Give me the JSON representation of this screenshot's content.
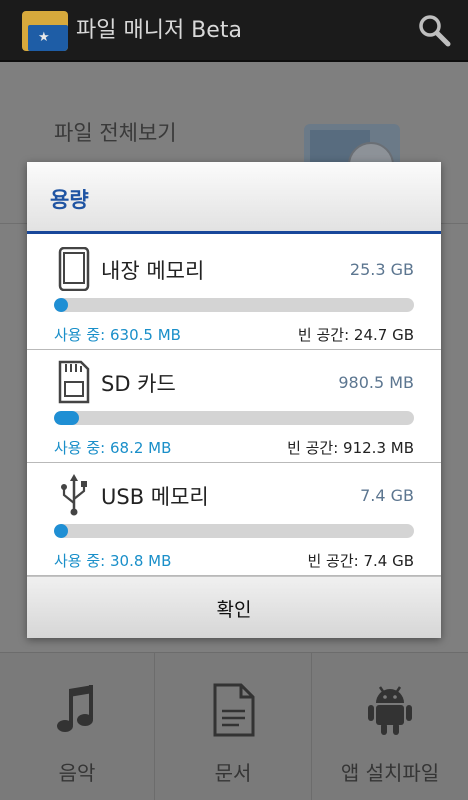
{
  "app": {
    "title": "파일 매니저 Beta",
    "icon": "folder-flag-icon",
    "search_icon": "search-icon"
  },
  "background": {
    "row1_label": "파일 전체보기",
    "bottom_items": [
      {
        "label": "음악",
        "icon": "music-note-icon"
      },
      {
        "label": "문서",
        "icon": "document-icon"
      },
      {
        "label": "앱 설치파일",
        "icon": "android-icon"
      }
    ]
  },
  "dialog": {
    "title": "용량",
    "ok_label": "확인",
    "storages": [
      {
        "name": "내장 메모리",
        "icon": "phone-icon",
        "total": "25.3 GB",
        "used": "사용 중: 630.5 MB",
        "free": "빈 공간: 24.7 GB",
        "usage_fraction": 0.025
      },
      {
        "name": "SD 카드",
        "icon": "sd-card-icon",
        "total": "980.5 MB",
        "used": "사용 중: 68.2 MB",
        "free": "빈 공간: 912.3 MB",
        "usage_fraction": 0.07
      },
      {
        "name": "USB 메모리",
        "icon": "usb-icon",
        "total": "7.4 GB",
        "used": "사용 중: 30.8 MB",
        "free": "빈 공간: 7.4 GB",
        "usage_fraction": 0.004
      }
    ]
  },
  "colors": {
    "accent_blue": "#1f54a3",
    "bar_fill": "#1f8fd4",
    "used_text": "#1a8fc9",
    "total_text": "#5c7690"
  }
}
